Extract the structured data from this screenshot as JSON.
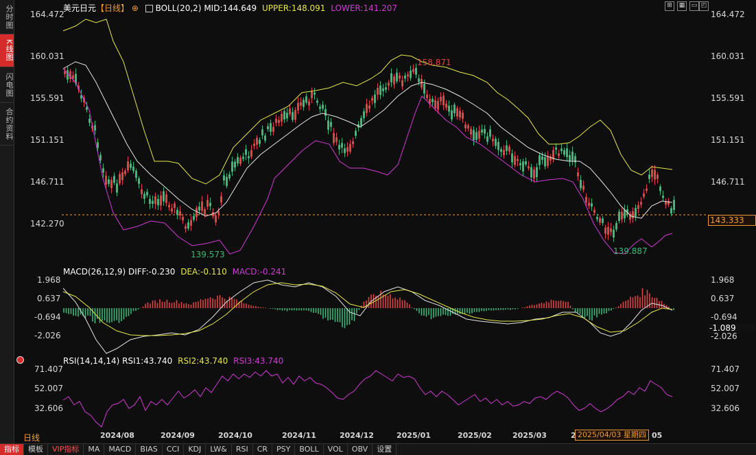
{
  "side_tabs": [
    {
      "label": "分时图",
      "active": false
    },
    {
      "label": "K线图",
      "active": true
    },
    {
      "label": "闪电图",
      "active": false
    },
    {
      "label": "合约资料",
      "active": false
    }
  ],
  "main_header": {
    "symbol": "美元日元",
    "period": "【日线】",
    "indicator": "BOLL(20,2)",
    "mid": "MID:144.649",
    "upper": "UPPER:148.091",
    "lower": "LOWER:141.207"
  },
  "main_axis": {
    "labels": [
      "164.472",
      "160.031",
      "155.591",
      "151.151",
      "146.711",
      "142.270"
    ]
  },
  "price_tag": "143.333",
  "annotations": {
    "high": "158.871",
    "low1": "139.573",
    "low2": "139.887"
  },
  "macd_header": {
    "title": "MACD(26,12,9)",
    "diff": "DIFF:-0.230",
    "dea": "DEA:-0.110",
    "macd": "MACD:-0.241"
  },
  "macd_axis": {
    "labels": [
      "1.968",
      "0.637",
      "-0.694",
      "-2.026"
    ],
    "tag": "-1.089"
  },
  "rsi_header": {
    "title": "RSI(14,14,14)",
    "rsi1": "RSI1:43.740",
    "rsi2": "RSI2:43.740",
    "rsi3": "RSI3:43.740"
  },
  "rsi_axis": {
    "labels": [
      "71.407",
      "52.007",
      "32.606"
    ]
  },
  "x_axis": {
    "labels": [
      "2024/08",
      "2024/09",
      "2024/10",
      "2024/11",
      "2024/12",
      "2025/01",
      "2025/02",
      "2025/03",
      "2",
      "05"
    ],
    "cursor": "2025/04/03 星期四"
  },
  "period_label": "日线",
  "bottom_tabs": [
    "指标",
    "模板",
    "VIP指标",
    "MA",
    "MACD",
    "BIAS",
    "CCI",
    "KDJ",
    "LW&",
    "RSI",
    "CR",
    "PSY",
    "BOLL",
    "VOL",
    "OBV",
    "设置"
  ],
  "colors": {
    "up": "#e04444",
    "down": "#3fb97a",
    "mid": "#e6e6e6",
    "upper": "#e8e84a",
    "lower": "#d23ad6",
    "dea": "#e8e84a",
    "macd": "#d23ad6",
    "accent": "#f29b32"
  }
}
